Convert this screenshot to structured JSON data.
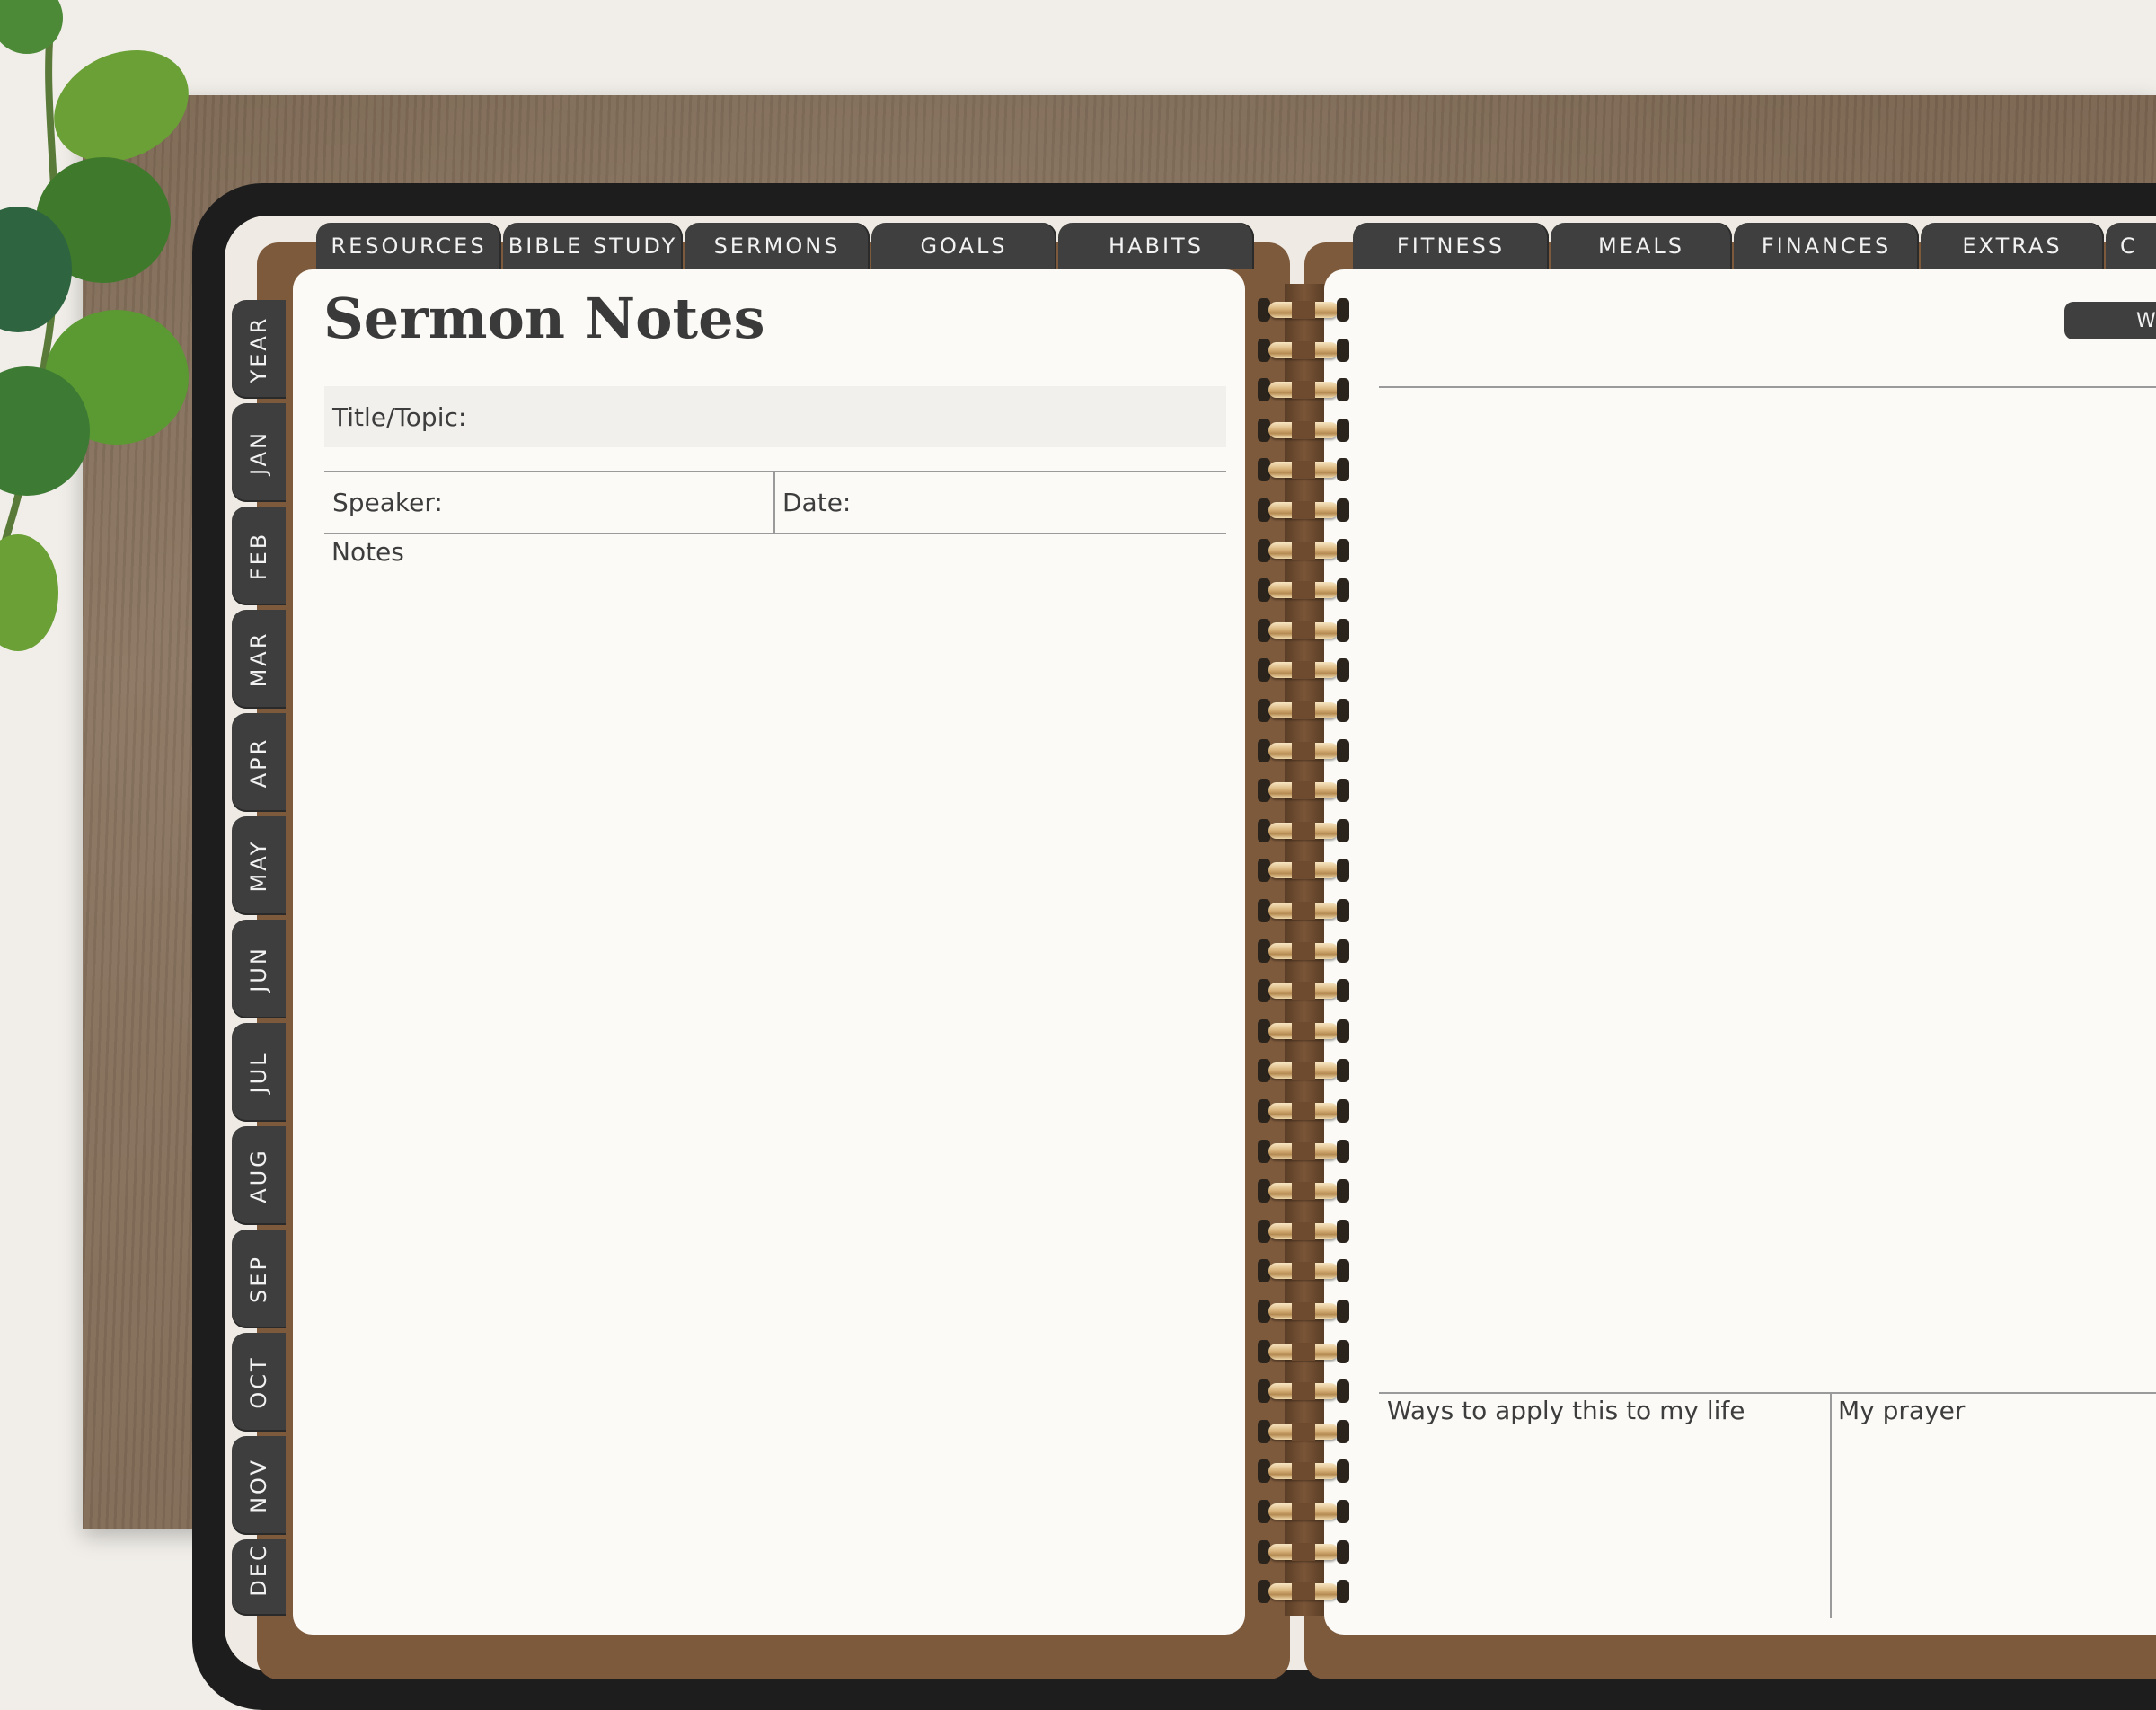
{
  "title": "Sermon Notes",
  "top_tabs_left": [
    "RESOURCES",
    "BIBLE STUDY",
    "SERMONS",
    "GOALS",
    "HABITS"
  ],
  "top_tabs_right": [
    "FITNESS",
    "MEALS",
    "FINANCES",
    "EXTRAS",
    "C"
  ],
  "side_tabs": [
    "YEAR",
    "JAN",
    "FEB",
    "MAR",
    "APR",
    "MAY",
    "JUN",
    "JUL",
    "AUG",
    "SEP",
    "OCT",
    "NOV",
    "DEC"
  ],
  "fields": {
    "title_topic": "Title/Topic:",
    "speaker": "Speaker:",
    "date": "Date:",
    "notes": "Notes",
    "ways_to_apply": "Ways to apply this to my life",
    "my_prayer": "My prayer"
  },
  "right_button_label": "W",
  "colors": {
    "tab": "#3f3f3f",
    "paper": "#fbfaf6",
    "leather": "#806b56",
    "spine": "#7e5a3c"
  }
}
